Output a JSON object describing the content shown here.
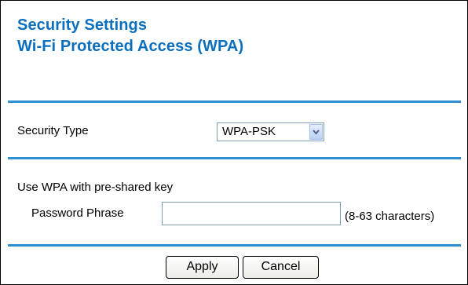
{
  "header": {
    "title": "Security Settings",
    "subtitle": "Wi-Fi Protected Access (WPA)"
  },
  "security_type": {
    "label": "Security Type",
    "selected": "WPA-PSK"
  },
  "psk_section": {
    "heading": "Use WPA with pre-shared key",
    "password_label": "Password Phrase",
    "password_value": "",
    "hint": "(8-63 characters)"
  },
  "actions": {
    "apply_label": "Apply",
    "cancel_label": "Cancel"
  },
  "colors": {
    "heading": "#0a6fbf",
    "separator": "#2f8fd0"
  }
}
